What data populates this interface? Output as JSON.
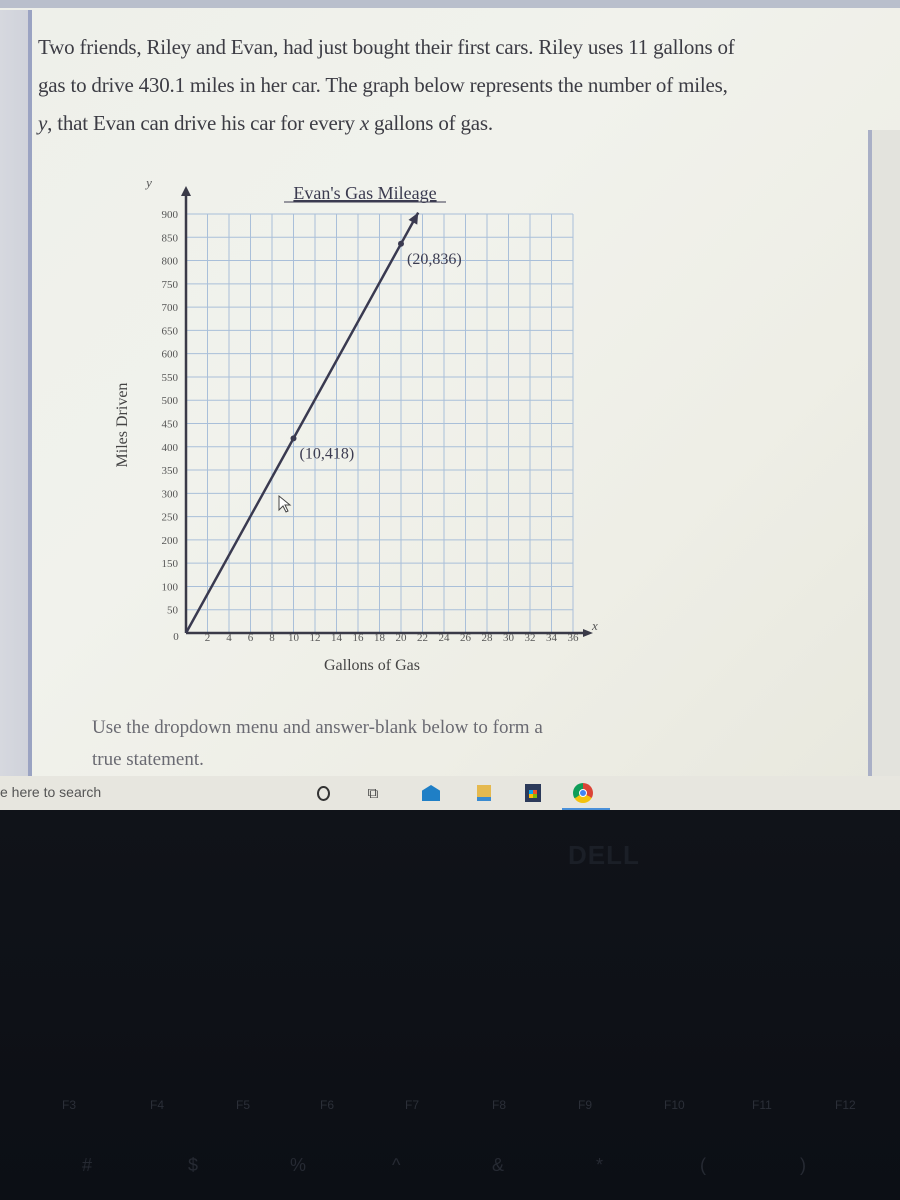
{
  "problem": {
    "line1": "Two friends, Riley and Evan, had just bought their first cars. Riley uses 11 gallons of",
    "line2": "gas to drive 430.1 miles in her car. The graph below represents the number of miles,",
    "line3_var_y": "y",
    "line3_mid": ", that Evan can drive his car for every ",
    "line3_var_x": "x",
    "line3_end": " gallons of gas."
  },
  "chart_data": {
    "type": "line",
    "title": "Evan's Gas Mileage",
    "xlabel": "Gallons of Gas",
    "ylabel": "Miles Driven",
    "x_axis_var": "x",
    "y_axis_var": "y",
    "xlim": [
      0,
      36
    ],
    "ylim": [
      0,
      900
    ],
    "x_ticks": [
      2,
      4,
      6,
      8,
      10,
      12,
      14,
      16,
      18,
      20,
      22,
      24,
      26,
      28,
      30,
      32,
      34,
      36
    ],
    "y_ticks": [
      50,
      100,
      150,
      200,
      250,
      300,
      350,
      400,
      450,
      500,
      550,
      600,
      650,
      700,
      750,
      800,
      850,
      900
    ],
    "origin_label": "0",
    "grid": true,
    "series": [
      {
        "name": "Evan",
        "x": [
          0,
          10,
          20,
          21.6
        ],
        "y": [
          0,
          418,
          836,
          903
        ],
        "arrow_end": true
      }
    ],
    "labeled_points": [
      {
        "x": 10,
        "y": 418,
        "label": "(10,418)"
      },
      {
        "x": 20,
        "y": 836,
        "label": "(20,836)"
      }
    ]
  },
  "instructions": {
    "line1": "Use the dropdown menu and answer-blank below to form a",
    "line2": "true statement."
  },
  "taskbar": {
    "search_placeholder": "e here to search",
    "icons": [
      "cortana-icon",
      "task-view-icon",
      "mail-icon",
      "file-explorer-icon",
      "store-icon",
      "chrome-icon"
    ]
  },
  "keyboard": {
    "brand": "DELL",
    "fkeys": [
      "F3",
      "F4",
      "F5",
      "F6",
      "F7",
      "F8",
      "F9",
      "F10",
      "F11",
      "F12"
    ],
    "symbols": [
      "#",
      "$",
      "%",
      "^",
      "&",
      "*",
      "(",
      ")"
    ]
  }
}
